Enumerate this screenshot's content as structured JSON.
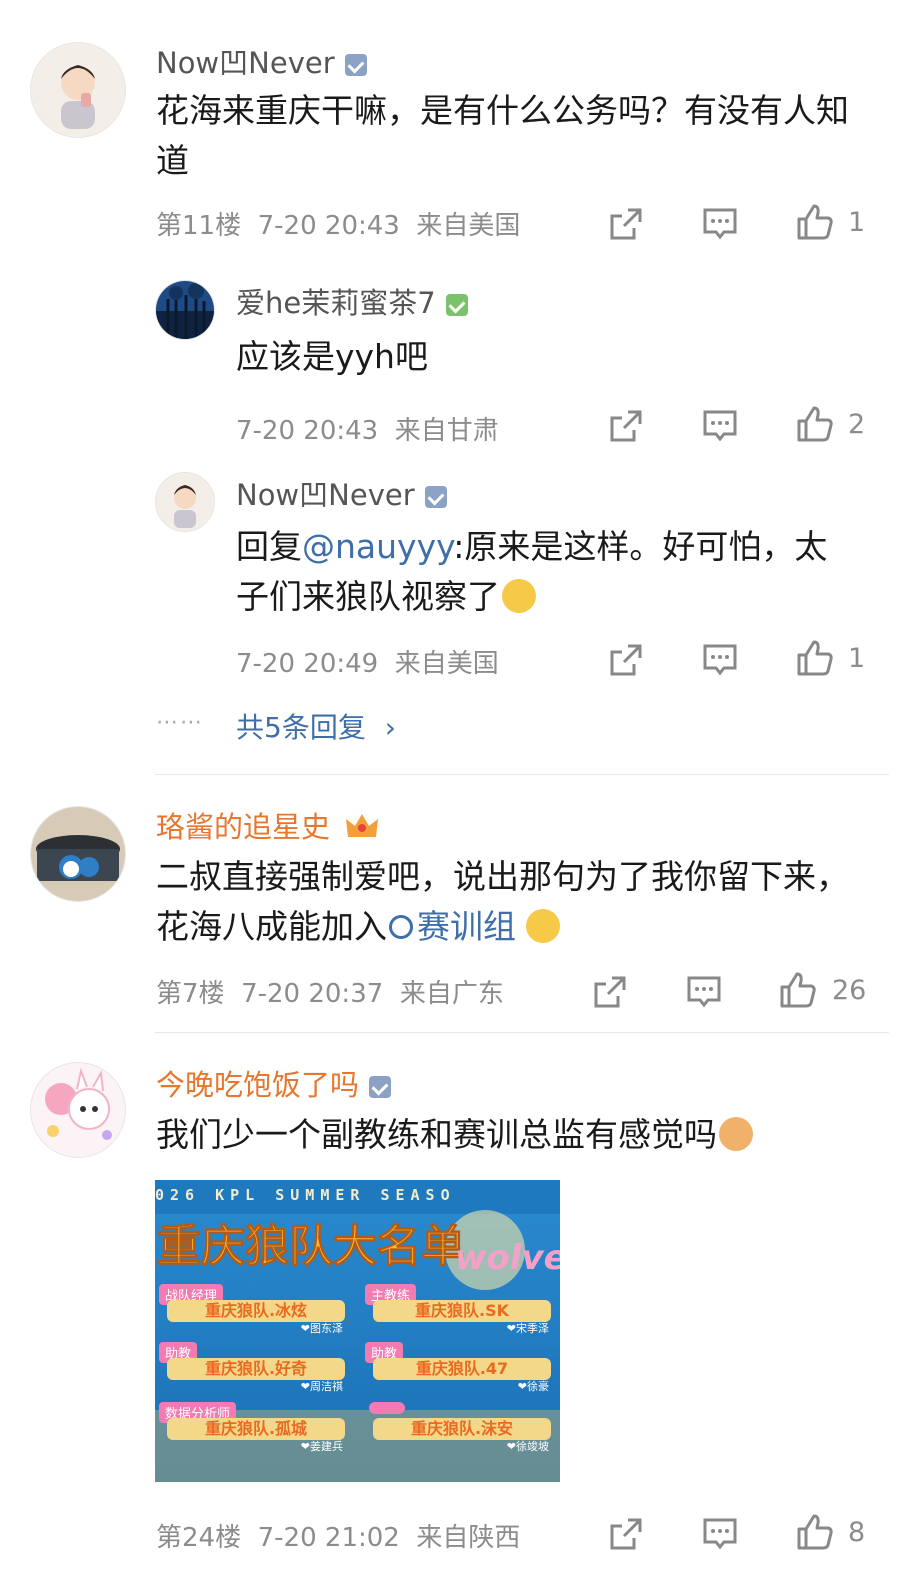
{
  "comments": [
    {
      "username": "Now凹Never",
      "text": "花海来重庆干嘛，是有什么公务吗？有没有人知道",
      "floor": "第11楼",
      "time": "7-20 20:43",
      "location": "来自美国",
      "likes": "1",
      "replies": [
        {
          "username": "爱he茉莉蜜茶7",
          "text": "应该是yyh吧",
          "time": "7-20 20:43",
          "location": "来自甘肃",
          "likes": "2"
        },
        {
          "username": "Now凹Never",
          "mention": "@nauyyy",
          "text_prefix": "回复",
          "text_after": ":原来是这样。好可怕，太子们来狼队视察了",
          "time": "7-20 20:49",
          "location": "来自美国",
          "likes": "1"
        }
      ],
      "more_replies": "共5条回复"
    },
    {
      "username": "珞酱的追星史",
      "text_before": "二叔直接强制爱吧，说出那句为了我你留下来，花海八成能加入",
      "topic_link": "赛训组",
      "floor": "第7楼",
      "time": "7-20 20:37",
      "location": "来自广东",
      "likes": "26"
    },
    {
      "username": "今晚吃饱饭了吗",
      "text": "我们少一个副教练和赛训总监有感觉吗",
      "floor": "第24楼",
      "time": "7-20 21:02",
      "location": "来自陕西",
      "likes": "8",
      "image": {
        "banner": "026 KPL SUMMER SEASO",
        "title": "重庆狼队大名单",
        "script": "wolve",
        "cards": [
          {
            "role": "战队经理",
            "name": "重庆狼队.冰炫",
            "real": "❤图东泽"
          },
          {
            "role": "主教练",
            "name": "重庆狼队.SK",
            "real": "❤宋季泽"
          },
          {
            "role": "助教",
            "name": "重庆狼队.好奇",
            "real": "❤周洁祺"
          },
          {
            "role": "助教",
            "name": "重庆狼队.47",
            "real": "❤徐豪"
          },
          {
            "role": "数据分析师",
            "name": "重庆狼队.孤城",
            "real": "❤姜建兵"
          },
          {
            "role": "",
            "name": "重庆狼队.沫安",
            "real": "❤徐竣坡"
          }
        ]
      }
    }
  ]
}
